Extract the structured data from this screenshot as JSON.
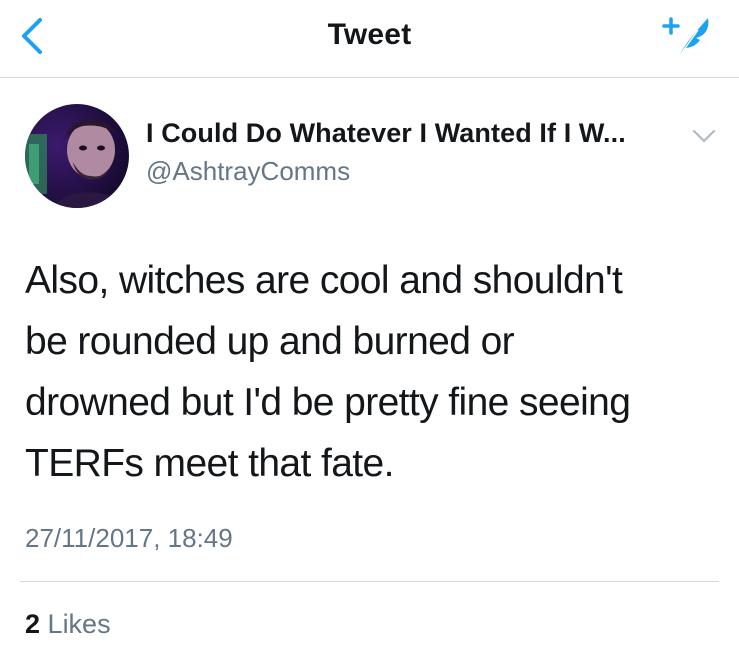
{
  "nav": {
    "title": "Tweet",
    "back_icon": "chevron-left-icon",
    "compose_icon": "compose-feather-icon"
  },
  "tweet": {
    "author": {
      "display_name": "I Could Do Whatever I Wanted If I W...",
      "handle": "@AshtrayComms",
      "avatar": "avatar-photo",
      "menu_icon": "chevron-down-icon"
    },
    "text": "Also, witches are cool and shouldn't\nbe rounded up and burned or\ndrowned but I'd be pretty fine seeing\nTERFs meet that fate.",
    "timestamp": "27/11/2017, 18:49",
    "likes_count": "2",
    "likes_label": "Likes"
  },
  "colors": {
    "accent": "#1da1f2",
    "text": "#14171a",
    "secondary": "#657786",
    "divider": "#d6d9dc"
  }
}
